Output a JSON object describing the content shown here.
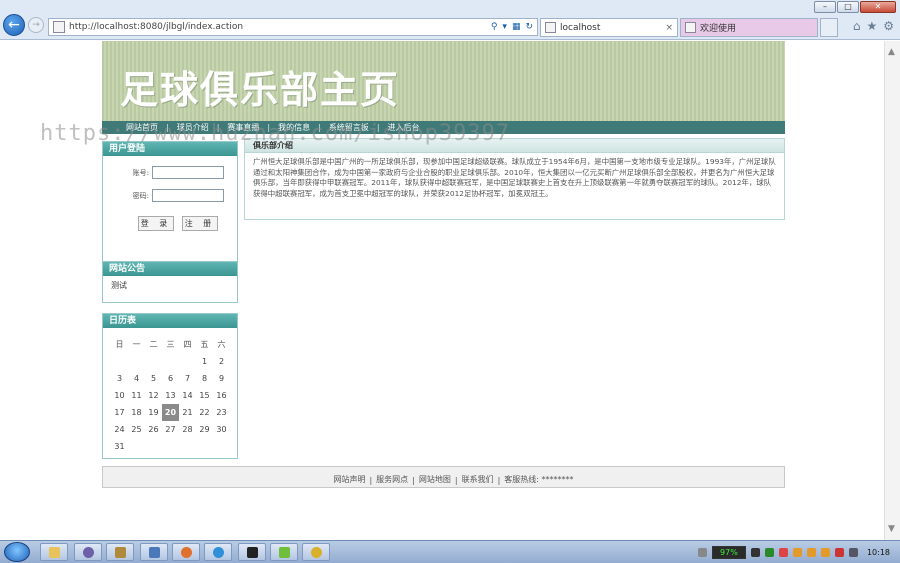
{
  "browser": {
    "address": "http://localhost:8080/jlbgl/index.action",
    "tabs": [
      {
        "label": "localhost"
      },
      {
        "label": "欢迎使用"
      }
    ],
    "window_buttons": [
      "–",
      "□",
      "✕"
    ]
  },
  "banner": {
    "title": "足球俱乐部主页"
  },
  "nav": {
    "items": [
      "网站首页",
      "球员介绍",
      "赛事直播",
      "我的信息",
      "系统留言板",
      "进入后台"
    ]
  },
  "watermark": "https://www.huzhan.com/ishop39397",
  "login": {
    "title": "用户登陆",
    "account_label": "账号:",
    "password_label": "密码:",
    "login_button": "登 录",
    "register_button": "注 册"
  },
  "notice": {
    "title": "网站公告",
    "body": "测试"
  },
  "calendar": {
    "title": "日历表",
    "weekdays": [
      "日",
      "一",
      "二",
      "三",
      "四",
      "五",
      "六"
    ],
    "weeks": [
      [
        "",
        "",
        "",
        "",
        "",
        "1",
        "2"
      ],
      [
        "3",
        "4",
        "5",
        "6",
        "7",
        "8",
        "9"
      ],
      [
        "10",
        "11",
        "12",
        "13",
        "14",
        "15",
        "16"
      ],
      [
        "17",
        "18",
        "19",
        "20",
        "21",
        "22",
        "23"
      ],
      [
        "24",
        "25",
        "26",
        "27",
        "28",
        "29",
        "30"
      ],
      [
        "31",
        "",
        "",
        "",
        "",
        "",
        ""
      ]
    ],
    "today": "20"
  },
  "club_intro": {
    "title": "俱乐部介绍",
    "text": "广州恒大足球俱乐部是中国广州的一所足球俱乐部，现参加中国足球超级联赛。球队成立于1954年6月，是中国第一支地市级专业足球队。1993年，广州足球队通过和太阳神集团合作，成为中国第一家政府与企业合股的职业足球俱乐部。2010年，恒大集团以一亿元买断广州足球俱乐部全部股权，并更名为广州恒大足球俱乐部，当年即获得中甲联赛冠军。2011年，球队获得中超联赛冠军，是中国足球联赛史上首支在升上顶级联赛第一年就勇夺联赛冠军的球队。2012年，球队获得中超联赛冠军，成为首支卫冕中超冠军的球队，并荣获2012足协杯冠军，加冕双冠王。"
  },
  "footer": {
    "links": [
      "网站声明",
      "服务网点",
      "网站地图",
      "联系我们",
      "客服热线: ********"
    ]
  },
  "taskbar": {
    "battery": "97%",
    "clock": "10:18"
  }
}
